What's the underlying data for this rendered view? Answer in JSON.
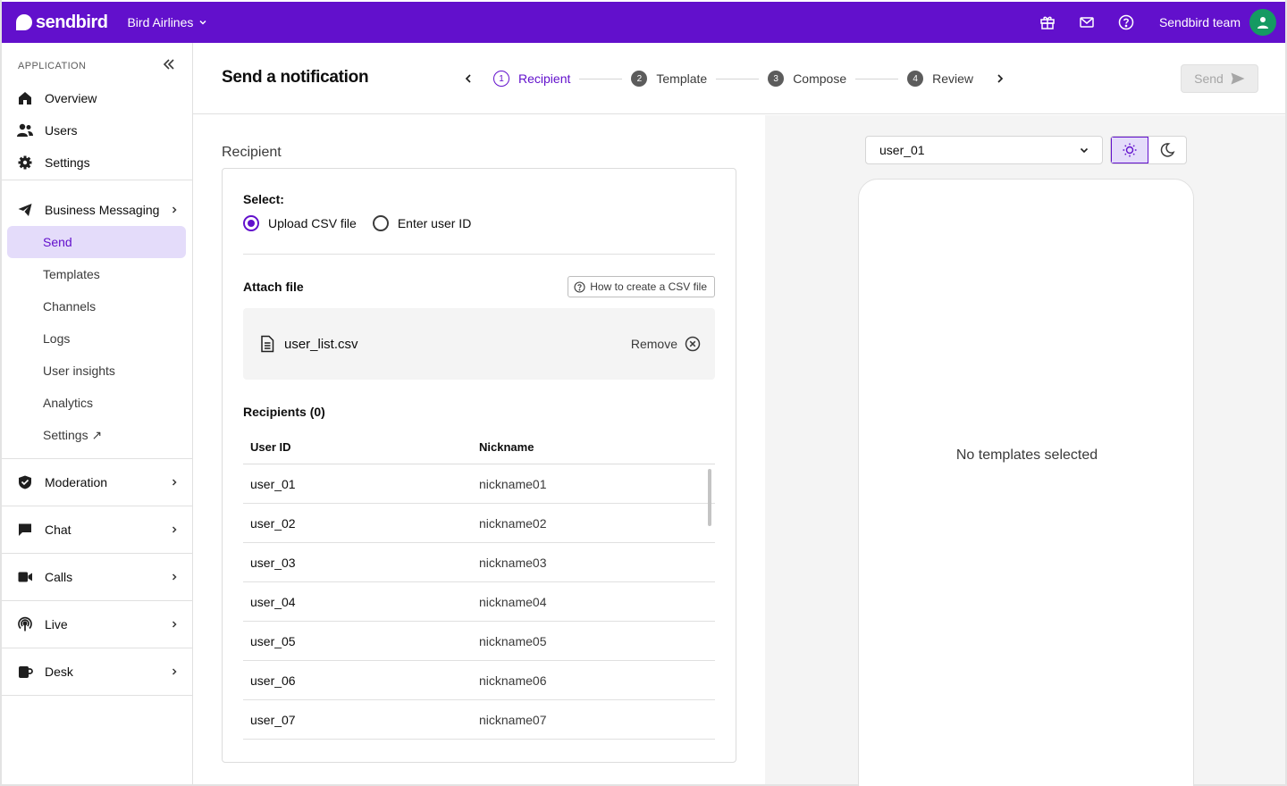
{
  "topbar": {
    "logo_text": "sendbird",
    "org_name": "Bird Airlines",
    "icons": [
      "gift-icon",
      "mail-icon",
      "help-icon"
    ],
    "user_name": "Sendbird team",
    "brand_color": "#6210cc"
  },
  "sidebar": {
    "section_label": "APPLICATION",
    "main_items": [
      {
        "label": "Overview",
        "icon": "home-icon"
      },
      {
        "label": "Users",
        "icon": "users-icon"
      },
      {
        "label": "Settings",
        "icon": "gear-icon"
      }
    ],
    "business_messaging": {
      "label": "Business Messaging",
      "icon": "send-icon",
      "sub_items": [
        {
          "label": "Send",
          "active": true
        },
        {
          "label": "Templates"
        },
        {
          "label": "Channels"
        },
        {
          "label": "Logs"
        },
        {
          "label": "User insights"
        },
        {
          "label": "Analytics"
        },
        {
          "label": "Settings ↗"
        }
      ]
    },
    "groups": [
      {
        "label": "Moderation",
        "icon": "shield-icon"
      },
      {
        "label": "Chat",
        "icon": "chat-icon"
      },
      {
        "label": "Calls",
        "icon": "video-icon"
      },
      {
        "label": "Live",
        "icon": "broadcast-icon"
      },
      {
        "label": "Desk",
        "icon": "desk-icon"
      }
    ]
  },
  "header": {
    "title": "Send a notification",
    "steps": [
      {
        "num": "1",
        "label": "Recipient",
        "active": true
      },
      {
        "num": "2",
        "label": "Template"
      },
      {
        "num": "3",
        "label": "Compose"
      },
      {
        "num": "4",
        "label": "Review"
      }
    ],
    "send_label": "Send"
  },
  "recipient": {
    "section_title": "Recipient",
    "select_label": "Select:",
    "options": [
      {
        "label": "Upload CSV file",
        "checked": true
      },
      {
        "label": "Enter user ID",
        "checked": false
      }
    ],
    "attach_label": "Attach file",
    "howto_label": "How to create a CSV file",
    "file_name": "user_list.csv",
    "remove_label": "Remove",
    "recipients_label": "Recipients (0)",
    "columns": [
      "User ID",
      "Nickname"
    ],
    "rows": [
      [
        "user_01",
        "nickname01"
      ],
      [
        "user_02",
        "nickname02"
      ],
      [
        "user_03",
        "nickname03"
      ],
      [
        "user_04",
        "nickname04"
      ],
      [
        "user_05",
        "nickname05"
      ],
      [
        "user_06",
        "nickname06"
      ],
      [
        "user_07",
        "nickname07"
      ]
    ]
  },
  "preview": {
    "selected_user": "user_01",
    "theme": "light",
    "empty_text": "No templates selected"
  }
}
